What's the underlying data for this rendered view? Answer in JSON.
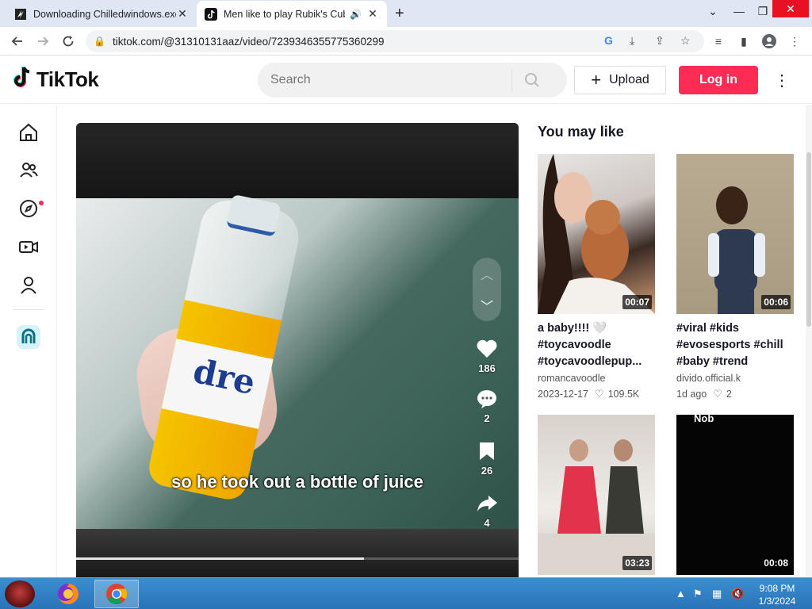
{
  "browser": {
    "tabs": [
      {
        "title": "Downloading Chilledwindows.exe",
        "active": false
      },
      {
        "title": "Men like to play Rubik's Cube",
        "active": true
      }
    ],
    "new_tab_label": "+",
    "url": "tiktok.com/@31310131aaz/video/7239346355775360299"
  },
  "header": {
    "logo_text": "TikTok",
    "search_placeholder": "Search",
    "upload_label": "Upload",
    "login_label": "Log in"
  },
  "rail": {
    "items": [
      "home-icon",
      "following-icon",
      "explore-icon",
      "live-icon",
      "profile-icon",
      "live-avatar-icon"
    ]
  },
  "video": {
    "caption": "so he took out a bottle of juice",
    "brand_text": "dre",
    "likes": "186",
    "comments": "2",
    "saves": "26",
    "shares": "4",
    "progress": 0.65
  },
  "you_may_like": {
    "title": "You may like",
    "cards": [
      {
        "title": "a baby!!!! 🤍 #toycavoodle #toycavoodlepup...",
        "author": "romancavoodle",
        "date": "2023-12-17",
        "likes": "109.5K",
        "duration": "00:07"
      },
      {
        "title": "#viral #kids #evosesports #chill #baby #trend",
        "author": "divido.official.k",
        "date": "1d ago",
        "likes": "2",
        "duration": "00:06"
      },
      {
        "title": "",
        "author": "",
        "date": "",
        "likes": "",
        "duration": "03:23"
      },
      {
        "title": "",
        "author": "",
        "date": "",
        "likes": "",
        "duration": "00:08",
        "overlay_text": "Nob"
      }
    ]
  },
  "taskbar": {
    "time": "9:08 PM",
    "date": "1/3/2024"
  }
}
